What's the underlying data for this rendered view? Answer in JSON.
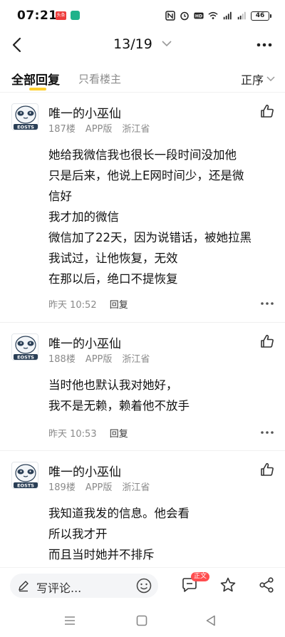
{
  "status_bar": {
    "time": "07:21",
    "app_badge": "头条",
    "battery": "46"
  },
  "nav": {
    "title": "13/19"
  },
  "tabs": {
    "all_label": "全部回复",
    "op_only_label": "只看楼主",
    "sort_label": "正序"
  },
  "posts": [
    {
      "author": "唯一的小巫仙",
      "floor": "187楼",
      "client": "APP版",
      "location": "浙江省",
      "lines": [
        "她给我微信我也很长一段时间没加他",
        "只是后来，他说上E网时间少，还是微",
        "信好",
        "我才加的微信",
        "微信加了22天，因为说错话，被她拉黑",
        "我试过，让他恢复，无效",
        "在那以后，绝口不提恢复"
      ],
      "time": "昨天 10:52",
      "reply_label": "回复"
    },
    {
      "author": "唯一的小巫仙",
      "floor": "188楼",
      "client": "APP版",
      "location": "浙江省",
      "lines": [
        "当时他也默认我对她好，",
        "我不是无赖，赖着他不放手"
      ],
      "time": "昨天 10:53",
      "reply_label": "回复"
    },
    {
      "author": "唯一的小巫仙",
      "floor": "189楼",
      "client": "APP版",
      "location": "浙江省",
      "lines": [
        "我知道我发的信息。他会看",
        "所以我才开",
        "而且当时她并不排斥"
      ]
    }
  ],
  "avatar_text": "EOSTS",
  "bottom_bar": {
    "comment_placeholder": "写评论...",
    "badge_text": "正文"
  },
  "colors": {
    "accent_underline": "#ffcf2e",
    "badge_red": "#ff4d4f",
    "meta_gray": "#8a8a8a"
  },
  "icons": [
    "back-arrow-icon",
    "chevron-down-icon",
    "more-dots-icon",
    "thumb-up-icon",
    "pen-icon",
    "emoji-icon",
    "comment-bubble-icon",
    "star-icon",
    "share-icon"
  ]
}
